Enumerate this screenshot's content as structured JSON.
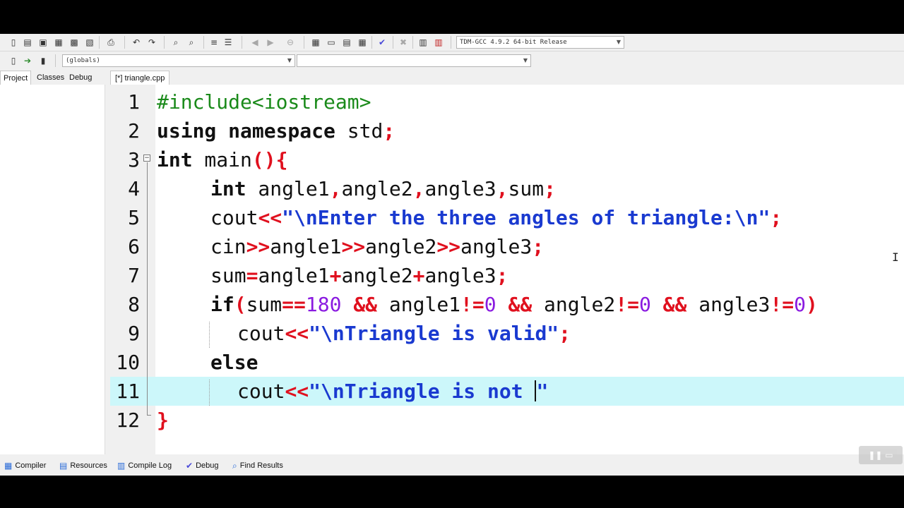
{
  "toolbar": {
    "compiler_profile": "TDM-GCC 4.9.2 64-bit Release",
    "scope_combo": "(globals)",
    "symbol_combo": ""
  },
  "left_panel": {
    "tabs": [
      "Project",
      "Classes",
      "Debug"
    ]
  },
  "editor": {
    "tab_label": "[*] triangle.cpp",
    "line_numbers": [
      "1",
      "2",
      "3",
      "4",
      "5",
      "6",
      "7",
      "8",
      "9",
      "10",
      "11",
      "12"
    ],
    "lines": {
      "l1": "#include<iostream>",
      "l2_kw": "using namespace",
      "l2_rest": " std",
      "l3_kw": "int",
      "l3_rest": " main",
      "l4_kw": "int",
      "l4_a1": " angle1",
      "l4_a2": "angle2",
      "l4_a3": "angle3",
      "l4_a4": "sum",
      "l5_id": "cout",
      "l5_str": "\"\\nEnter the three angles of triangle:\\n\"",
      "l6_id": "cin",
      "l6_a1": "angle1",
      "l6_a2": "angle2",
      "l6_a3": "angle3",
      "l7_sum": "sum",
      "l7_a1": "angle1",
      "l7_a2": "angle2",
      "l7_a3": "angle3",
      "l8_kw": "if",
      "l8_sum": "sum",
      "l8_180": "180",
      "l8_a1": " angle1",
      "l8_a2": " angle2",
      "l8_a3": " angle3",
      "l8_zero": "0",
      "l9_id": "cout",
      "l9_str": "\"\\nTriangle is valid\"",
      "l10_kw": "else",
      "l11_id": "cout",
      "l11_str_a": "\"\\nTriangle is not ",
      "l11_str_b": "\"",
      "l12": "}"
    },
    "current_line": 11
  },
  "bottom_tabs": {
    "compiler": "Compiler",
    "resources": "Resources",
    "compile_log": "Compile Log",
    "debug": "Debug",
    "find_results": "Find Results"
  },
  "colors": {
    "operator": "#e0101e",
    "string": "#1a3ad0",
    "number": "#8a1ae0",
    "preprocessor": "#1a8a1a",
    "current_line": "#ccf7fa"
  }
}
